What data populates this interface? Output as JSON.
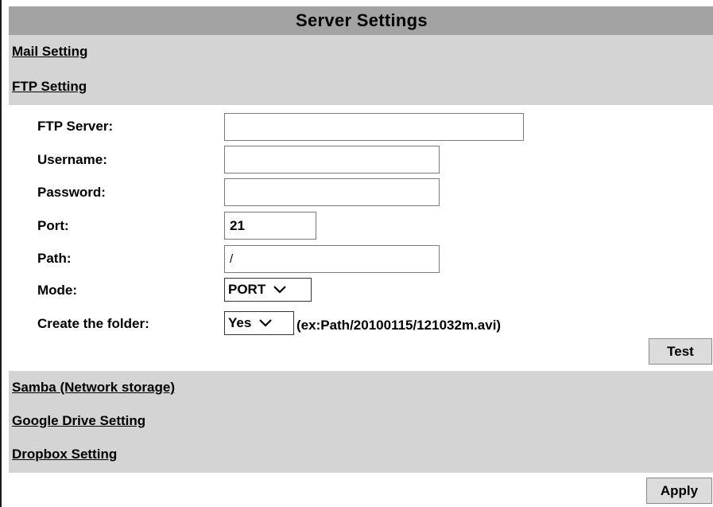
{
  "page": {
    "title": "Server Settings"
  },
  "sections": {
    "mail": "Mail Setting",
    "ftp": "FTP Setting",
    "samba": "Samba (Network storage)",
    "google_drive": "Google Drive Setting",
    "dropbox": "Dropbox Setting"
  },
  "ftp": {
    "server_label": "FTP Server:",
    "server_value": "",
    "username_label": "Username:",
    "username_value": "",
    "password_label": "Password:",
    "password_value": "",
    "port_label": "Port:",
    "port_value": "21",
    "path_label": "Path:",
    "path_value": "/",
    "mode_label": "Mode:",
    "mode_value": "PORT",
    "folder_label": "Create the folder:",
    "folder_value": "Yes",
    "folder_hint": "(ex:Path/20100115/121032m.avi)",
    "test_label": "Test"
  },
  "footer": {
    "apply_label": "Apply"
  },
  "icons": {
    "dropdown": "chevron-down-icon"
  },
  "colors": {
    "title_bg": "#a3a3a3",
    "section_bg": "#d4d4d4",
    "button_bg": "#dcdcdc"
  }
}
